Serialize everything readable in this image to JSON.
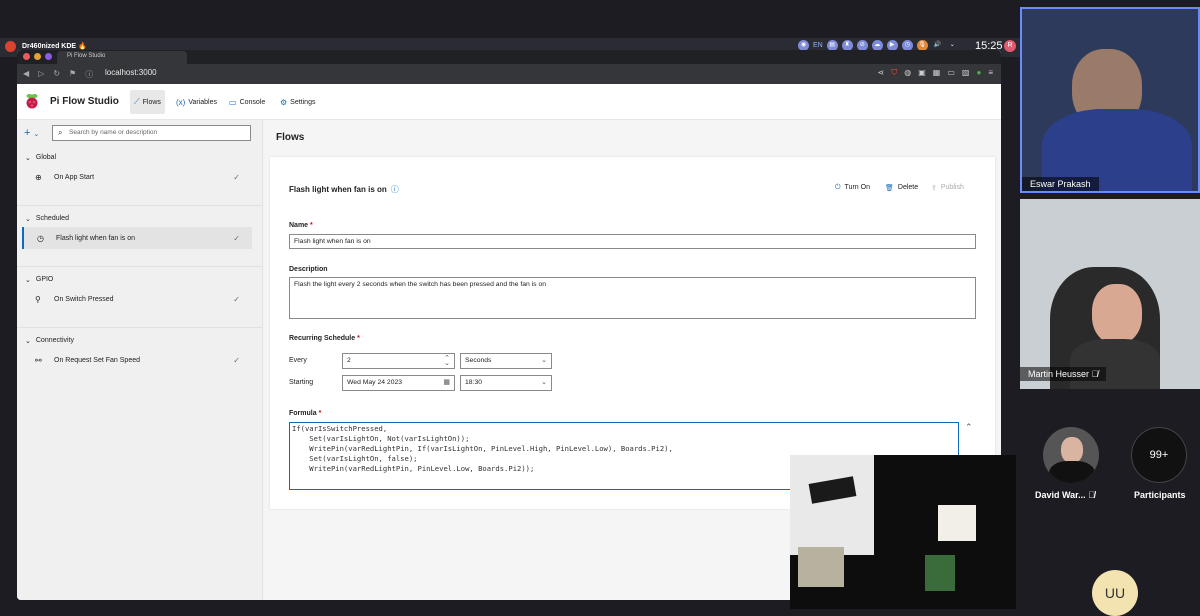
{
  "desktop": {
    "panel_title": "Dr460nized KDE 🔥",
    "clock": "15:25",
    "lang": "EN",
    "user_initial": "R"
  },
  "browser": {
    "tab_title": "Pi Flow Studio",
    "url": "localhost:3000"
  },
  "app": {
    "title": "Pi Flow Studio",
    "nav": [
      {
        "label": "Flows",
        "icon": "flows-icon"
      },
      {
        "label": "Variables",
        "icon": "variables-icon"
      },
      {
        "label": "Console",
        "icon": "console-icon"
      },
      {
        "label": "Settings",
        "icon": "gear-icon"
      }
    ],
    "search_placeholder": "Search by name or description",
    "groups": [
      {
        "label": "Global",
        "items": [
          {
            "label": "On App Start",
            "icon": "globe-icon"
          }
        ]
      },
      {
        "label": "Scheduled",
        "items": [
          {
            "label": "Flash light when fan is on",
            "icon": "timer-icon"
          }
        ]
      },
      {
        "label": "GPIO",
        "items": [
          {
            "label": "On Switch Pressed",
            "icon": "pin-icon"
          }
        ]
      },
      {
        "label": "Connectivity",
        "items": [
          {
            "label": "On Request Set Fan Speed",
            "icon": "network-icon"
          }
        ]
      }
    ],
    "main_title": "Flows",
    "flow": {
      "title": "Flash light when fan is on",
      "actions": {
        "turn_on": "Turn On",
        "delete": "Delete",
        "publish": "Publish"
      },
      "name_label": "Name",
      "name_value": "Flash light when fan is on",
      "description_label": "Description",
      "description_value": "Flash the light every 2 seconds when the switch has been pressed and the fan is on",
      "schedule_label": "Recurring Schedule",
      "every_label": "Every",
      "every_value": "2",
      "every_unit": "Seconds",
      "starting_label": "Starting",
      "starting_date": "Wed May 24 2023",
      "starting_time": "18:30",
      "formula_label": "Formula",
      "formula_lines": [
        "If(varIsSwitchPressed,",
        "    Set(varIsLightOn, Not(varIsLightOn));",
        "    WritePin(varRedLightPin, If(varIsLightOn, PinLevel.High, PinLevel.Low), Boards.Pi2),",
        "    Set(varIsLightOn, false);",
        "    WritePin(varRedLightPin, PinLevel.Low, Boards.Pi2));"
      ],
      "required_mark": "*"
    }
  },
  "call": {
    "participants": [
      {
        "name": "Eswar Prakash"
      },
      {
        "name": "Martin Heusser"
      },
      {
        "name": "David War..."
      }
    ],
    "participants_count": "99+",
    "participants_label": "Participants",
    "avatar_initials": "UU"
  }
}
